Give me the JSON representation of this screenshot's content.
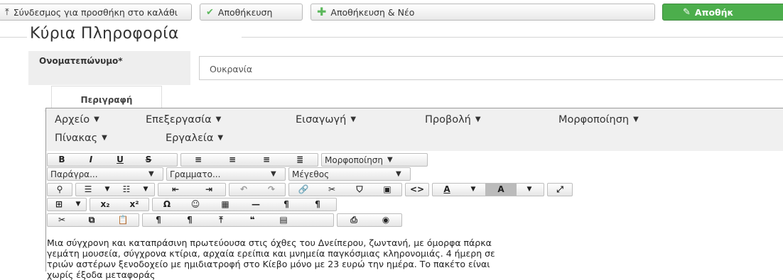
{
  "toolbar": {
    "add_link_label": "Σύνδεσμος για προσθήκη στο καλάθι",
    "save_label": "Αποθήκευση",
    "save_new_label": "Αποθήκευση & Νέο",
    "save_close_label": "Αποθήκ"
  },
  "section": {
    "legend": "Κύρια Πληροφορία"
  },
  "name_field": {
    "label": "Ονοματεπώνυμο*",
    "value": "Ουκρανία"
  },
  "tabs": [
    {
      "label": "Περιγραφή"
    }
  ],
  "editor": {
    "menus": [
      "Αρχείο",
      "Επεξεργασία",
      "Εισαγωγή",
      "Προβολή",
      "Μορφοποίηση",
      "Πίνακας",
      "Εργαλεία"
    ],
    "format_dropdown": "Μορφοποίηση",
    "paragraph_dropdown": "Παράγρα...",
    "font_dropdown": "Γραμματο...",
    "size_dropdown": "Μέγεθος",
    "content_lines": [
      "Μια σύγχρονη και καταπράσινη πρωτεύουσα στις όχθες του Δνείπερου, ζωντανή, με όμορφα πάρκα",
      "γεμάτη μουσεία, σύγχρονα κτίρια, αρχαία ερείπια και μνημεία παγκόσμιας κληρονομιάς. 4 ήμερη σε",
      "τριών αστέρων ξενοδοχείο με ημιδιατροφή στο Κίεβο μόνο με 23 ευρώ την ημέρα.  Το πακέτο είναι",
      "χωρίς έξοδα μεταφοράς"
    ]
  },
  "colors": {
    "green": "#4cae4c",
    "menubar_bg": "#f0f0f0",
    "label_bg": "#eeeeee"
  }
}
